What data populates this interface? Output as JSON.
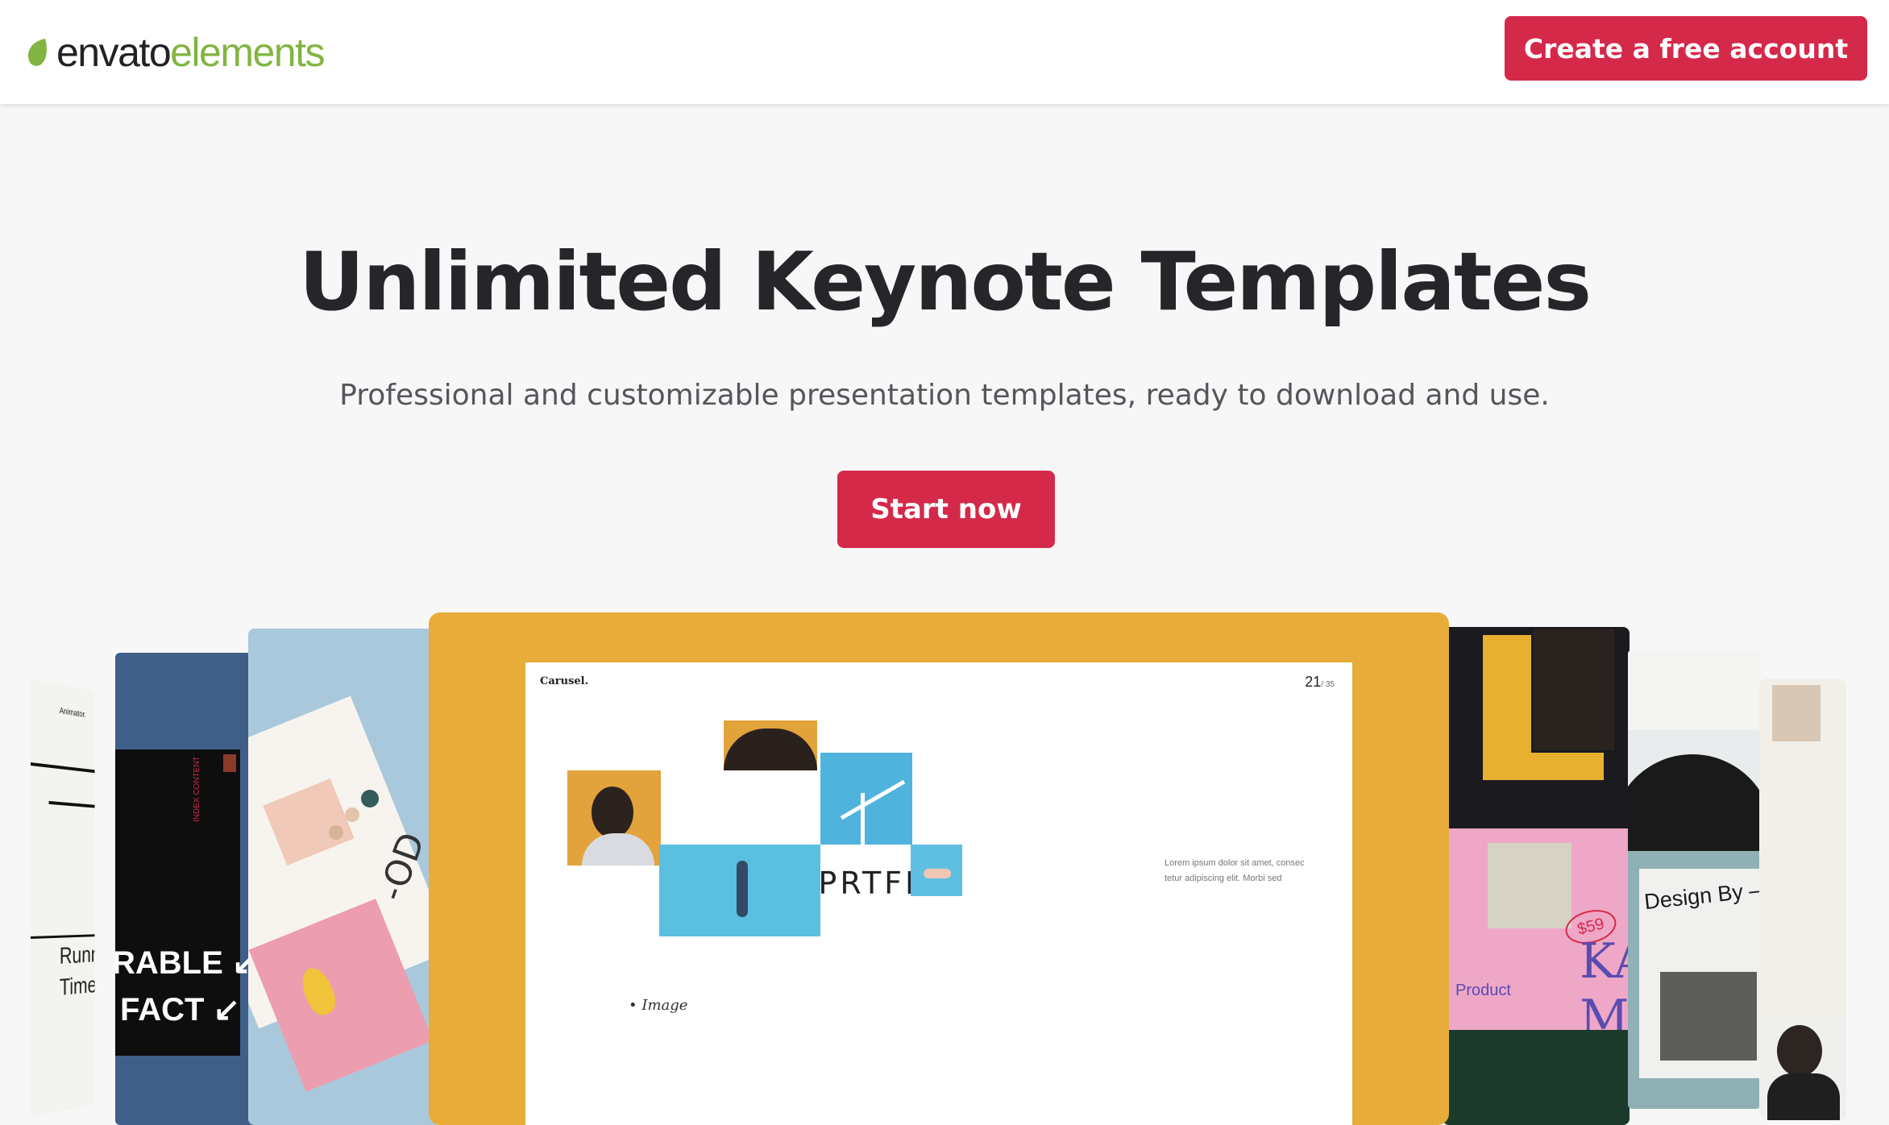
{
  "header": {
    "logo_part1": "envato",
    "logo_part2": "elements",
    "cta_label": "Create a free account"
  },
  "hero": {
    "title": "Unlimited Keynote Templates",
    "subtitle": "Professional and customizable presentation templates, ready to download and use.",
    "cta_label": "Start now"
  },
  "showcase": {
    "main_slide": {
      "brand": "Carusel.",
      "page_number": "21",
      "page_total": "/ 35",
      "logo_text": "//PRTFL",
      "lorem": "Lorem ipsum dolor sit amet, consec tetur adipiscing elit. Morbi sed",
      "image_label": "• Image"
    },
    "left_card_far": {
      "text_a": "Animator.",
      "text_b": "Runn",
      "text_c": "Time"
    },
    "left_card_blue": {
      "line1": "RABLE ↙",
      "line2": "FACT ↙",
      "vertical_label": "INDEX CONTENT"
    },
    "left_card_mid": {
      "label": "-OD"
    },
    "right_card_pink": {
      "product_label": "Product",
      "price_tag": "$59",
      "big_text": "KA",
      "big_text_2": "MI"
    },
    "right_card_arch": {
      "label": "Design By —"
    }
  },
  "colors": {
    "brand_red": "#d5294a",
    "envato_green": "#82b541",
    "page_bg": "#f7f7f8",
    "main_card": "#e7ac3a"
  }
}
